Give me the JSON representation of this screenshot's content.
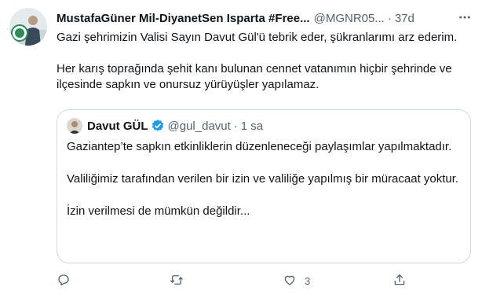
{
  "tweet": {
    "author": {
      "name": "MustafaGüner Mil-DiyanetSen Isparta #Free...",
      "handle": "@MGNR05...",
      "time": "37d"
    },
    "paragraphs": [
      "Gazi şehrimizin Valisi Sayın Davut Gül'ü tebrik eder, şükranlarımı arz ederim.",
      "Her karış toprağında şehit kanı bulunan cennet vatanımın hiçbir şehrinde ve ilçesinde sapkın ve onursuz yürüyüşler yapılamaz."
    ],
    "quoted": {
      "name": "Davut GÜL",
      "handle": "@gul_davut",
      "time": "1 sa",
      "paragraphs": [
        "Gaziantep’te sapkın etkinliklerin düzenleneceği  paylaşımlar yapılmaktadır.",
        "Valiliğimiz tarafından verilen bir izin ve  valiliğe yapılmış bir müracaat yoktur.",
        "İzin verilmesi de mümkün değildir..."
      ]
    },
    "actions": {
      "like_count": "3"
    }
  },
  "icons": {
    "more": "more-horizontal-icon",
    "reply": "reply-icon",
    "retweet": "retweet-icon",
    "like": "heart-icon",
    "share": "share-icon",
    "verified": "verified-badge-icon"
  },
  "colors": {
    "text": "#0f1419",
    "secondary": "#536471",
    "border": "#cfd9de",
    "verified": "#1d9bf0"
  }
}
